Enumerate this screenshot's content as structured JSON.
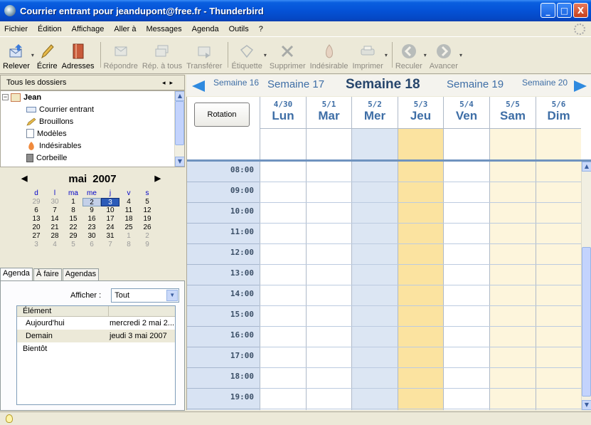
{
  "window": {
    "title": "Courrier entrant pour jeandupont@free.fr - Thunderbird",
    "controls": [
      "_",
      "□",
      "X"
    ]
  },
  "menu": [
    "Fichier",
    "Édition",
    "Affichage",
    "Aller à",
    "Messages",
    "Agenda",
    "Outils",
    "?"
  ],
  "toolbar": [
    {
      "label": "Relever",
      "icon": "get-mail-icon",
      "enabled": true
    },
    {
      "label": "Écrire",
      "icon": "write-icon",
      "enabled": true
    },
    {
      "label": "Adresses",
      "icon": "address-book-icon",
      "enabled": true
    },
    {
      "label": "Répondre",
      "icon": "reply-icon",
      "enabled": false
    },
    {
      "label": "Rép. à tous",
      "icon": "reply-all-icon",
      "enabled": false
    },
    {
      "label": "Transférer",
      "icon": "forward-icon",
      "enabled": false
    },
    {
      "label": "Étiquette",
      "icon": "tag-icon",
      "enabled": false
    },
    {
      "label": "Supprimer",
      "icon": "delete-icon",
      "enabled": false
    },
    {
      "label": "Indésirable",
      "icon": "junk-icon",
      "enabled": false
    },
    {
      "label": "Imprimer",
      "icon": "print-icon",
      "enabled": false
    },
    {
      "label": "Reculer",
      "icon": "back-icon",
      "enabled": false
    },
    {
      "label": "Avancer",
      "icon": "forward-nav-icon",
      "enabled": false
    }
  ],
  "folders": {
    "header": "Tous les dossiers",
    "account": "Jean",
    "items": [
      "Courrier entrant",
      "Brouillons",
      "Modèles",
      "Indésirables",
      "Corbeille"
    ]
  },
  "minical": {
    "month": "mai",
    "year": "2007",
    "daynames": [
      "d",
      "l",
      "ma",
      "me",
      "j",
      "v",
      "s"
    ],
    "days": [
      [
        "29",
        "30",
        "1",
        "2",
        "3",
        "4",
        "5"
      ],
      [
        "6",
        "7",
        "8",
        "9",
        "10",
        "11",
        "12"
      ],
      [
        "13",
        "14",
        "15",
        "16",
        "17",
        "18",
        "19"
      ],
      [
        "20",
        "21",
        "22",
        "23",
        "24",
        "25",
        "26"
      ],
      [
        "27",
        "28",
        "29",
        "30",
        "31",
        "1",
        "2"
      ],
      [
        "3",
        "4",
        "5",
        "6",
        "7",
        "8",
        "9"
      ]
    ],
    "selected": "2",
    "today": "3"
  },
  "tabs": [
    "Agenda",
    "À faire",
    "Agendas"
  ],
  "agenda": {
    "filter_label": "Afficher :",
    "filter_value": "Tout",
    "column": "Élément",
    "rows": [
      {
        "label": "Aujourd'hui",
        "value": "mercredi 2 mai 2..."
      },
      {
        "label": "Demain",
        "value": "jeudi 3 mai 2007"
      },
      {
        "label": "Bientôt",
        "value": ""
      }
    ]
  },
  "weeknav": [
    "Semaine 16",
    "Semaine 17",
    "Semaine 18",
    "Semaine 19",
    "Semaine 20"
  ],
  "rotation_label": "Rotation",
  "days": [
    {
      "date": "4/30",
      "name": "Lun"
    },
    {
      "date": "5/1",
      "name": "Mar"
    },
    {
      "date": "5/2",
      "name": "Mer"
    },
    {
      "date": "5/3",
      "name": "Jeu"
    },
    {
      "date": "5/4",
      "name": "Ven"
    },
    {
      "date": "5/5",
      "name": "Sam"
    },
    {
      "date": "5/6",
      "name": "Dim"
    }
  ],
  "hours": [
    "08:00",
    "09:00",
    "10:00",
    "11:00",
    "12:00",
    "13:00",
    "14:00",
    "15:00",
    "16:00",
    "17:00",
    "18:00",
    "19:00"
  ],
  "colors": {
    "selected_day": "#dce6f3",
    "today": "#fbe3a0",
    "weekend": "#fdf5dc",
    "week_link": "#3e6ea6"
  }
}
